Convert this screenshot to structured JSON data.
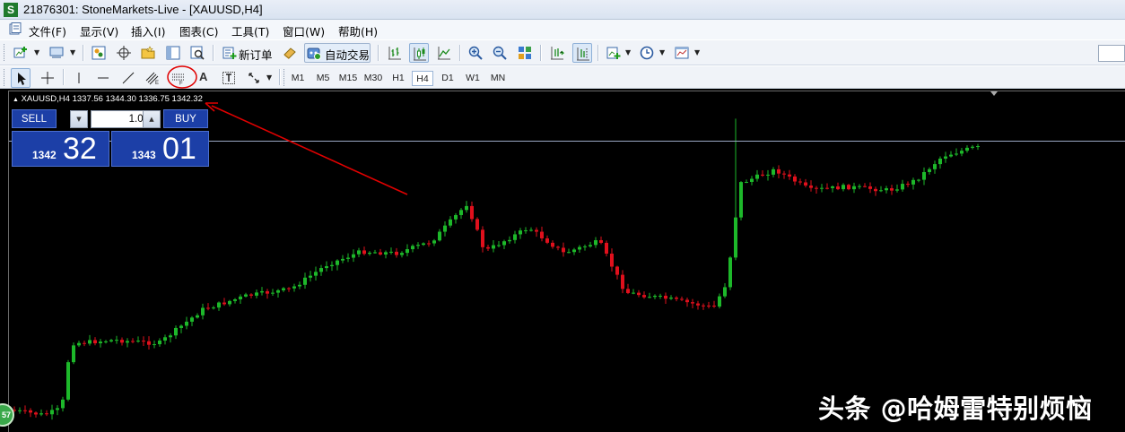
{
  "window": {
    "title": "21876301: StoneMarkets-Live - [XAUUSD,H4]",
    "app_icon": "S"
  },
  "menu": [
    {
      "label": "文件(F)",
      "name": "menu-file"
    },
    {
      "label": "显示(V)",
      "name": "menu-view"
    },
    {
      "label": "插入(I)",
      "name": "menu-insert"
    },
    {
      "label": "图表(C)",
      "name": "menu-charts"
    },
    {
      "label": "工具(T)",
      "name": "menu-tools"
    },
    {
      "label": "窗口(W)",
      "name": "menu-window"
    },
    {
      "label": "帮助(H)",
      "name": "menu-help"
    }
  ],
  "toolbar": {
    "new_order_label": "新订单",
    "auto_trade_label": "自动交易"
  },
  "draw_tools": {
    "text_tool": "A"
  },
  "timeframes": [
    "M1",
    "M5",
    "M15",
    "M30",
    "H1",
    "H4",
    "D1",
    "W1",
    "MN"
  ],
  "selected_timeframe": "H4",
  "chart": {
    "header": "XAUUSD,H4  1337.56 1344.30 1336.75 1342.32",
    "symbol": "XAUUSD",
    "period": "H4"
  },
  "one_click": {
    "sell_label": "SELL",
    "buy_label": "BUY",
    "lot": "1.00",
    "sell_price_small": "1342",
    "sell_price_big": "32",
    "buy_price_small": "1343",
    "buy_price_big": "01"
  },
  "watermark": "头条 @哈姆雷特别烦恼",
  "badge": "57",
  "colors": {
    "bull": "#1db82a",
    "bear": "#e0101c",
    "panel": "#1c3fa7",
    "annotation": "#e00000",
    "price_line": "#9aa7c4"
  },
  "chart_data": {
    "type": "candlestick",
    "symbol": "XAUUSD",
    "timeframe": "H4",
    "last_bar": {
      "open": 1337.56,
      "high": 1344.3,
      "low": 1336.75,
      "close": 1342.32
    },
    "bid": 1342.32,
    "ask": 1343.01,
    "trend": [
      [
        0.0,
        0.935
      ],
      [
        0.04,
        0.95
      ],
      [
        0.06,
        0.93
      ],
      [
        0.07,
        0.74
      ],
      [
        0.12,
        0.73
      ],
      [
        0.17,
        0.74
      ],
      [
        0.22,
        0.64
      ],
      [
        0.27,
        0.6
      ],
      [
        0.32,
        0.58
      ],
      [
        0.36,
        0.51
      ],
      [
        0.4,
        0.47
      ],
      [
        0.44,
        0.475
      ],
      [
        0.48,
        0.44
      ],
      [
        0.52,
        0.33
      ],
      [
        0.54,
        0.47
      ],
      [
        0.59,
        0.4
      ],
      [
        0.63,
        0.475
      ],
      [
        0.67,
        0.44
      ],
      [
        0.7,
        0.59
      ],
      [
        0.75,
        0.61
      ],
      [
        0.8,
        0.635
      ],
      [
        0.815,
        0.56
      ],
      [
        0.83,
        0.27
      ],
      [
        0.87,
        0.23
      ],
      [
        0.91,
        0.29
      ],
      [
        0.95,
        0.28
      ],
      [
        1.0,
        0.29
      ],
      [
        1.03,
        0.26
      ],
      [
        1.06,
        0.19
      ],
      [
        1.095,
        0.165
      ]
    ],
    "spike": {
      "x": 0.818,
      "high": 0.08
    }
  }
}
